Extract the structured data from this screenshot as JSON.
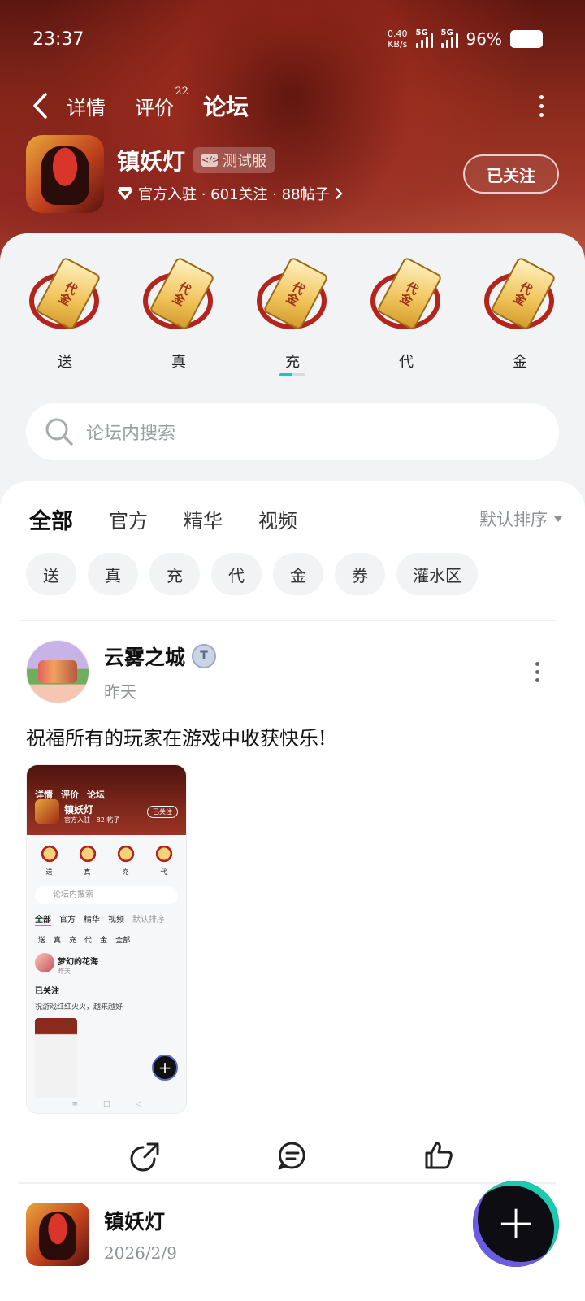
{
  "status_bar": {
    "time": "23:37",
    "net_speed_value": "0.40",
    "net_speed_unit": "KB/s",
    "signal_1": "5G",
    "signal_2": "5G",
    "battery": "96%"
  },
  "nav": {
    "tabs": [
      {
        "label": "详情"
      },
      {
        "label": "评价",
        "count": "22"
      },
      {
        "label": "论坛"
      }
    ],
    "active_tab": "论坛"
  },
  "game": {
    "title": "镇妖灯",
    "badge": "测试服",
    "meta": "官方入驻 · 601关注 · 88帖子",
    "follow_label": "已关注"
  },
  "quick_categories": [
    {
      "label": "送",
      "icon": "voucher-scroll-icon",
      "scroll_text": "代金"
    },
    {
      "label": "真",
      "icon": "voucher-scroll-icon",
      "scroll_text": "代金"
    },
    {
      "label": "充",
      "icon": "voucher-scroll-icon",
      "scroll_text": "代金"
    },
    {
      "label": "代",
      "icon": "voucher-scroll-icon",
      "scroll_text": "代金"
    },
    {
      "label": "金",
      "icon": "voucher-scroll-icon",
      "scroll_text": "代金"
    }
  ],
  "search": {
    "placeholder": "论坛内搜索"
  },
  "feed_tabs": [
    "全部",
    "官方",
    "精华",
    "视频"
  ],
  "sort_label": "默认排序",
  "chips": [
    "送",
    "真",
    "充",
    "代",
    "金",
    "券",
    "灌水区"
  ],
  "posts": [
    {
      "author": "云雾之城",
      "badge": "T",
      "time": "昨天",
      "text": "祝福所有的玩家在游戏中收获快乐!",
      "screenshot": {
        "nav": [
          "详情",
          "评价",
          "论坛"
        ],
        "title": "镇妖灯",
        "meta": "官方入驻 · 82 帖子",
        "follow": "已关注",
        "cats": [
          "送",
          "真",
          "充",
          "代"
        ],
        "search": "论坛内搜索",
        "tabs": [
          "全部",
          "官方",
          "精华",
          "视频"
        ],
        "sort": "默认排序",
        "chips": [
          "送",
          "真",
          "充",
          "代",
          "金",
          "全部"
        ],
        "post_author": "梦幻的花海",
        "post_time": "昨天",
        "post_follow": "已关注",
        "post_text": "祝游戏红红火火，越来越好"
      }
    },
    {
      "author": "镇妖灯",
      "time": "2026/2/9"
    }
  ],
  "colors": {
    "accent": "#19c9b4",
    "header_red": "#8a2a1c"
  }
}
